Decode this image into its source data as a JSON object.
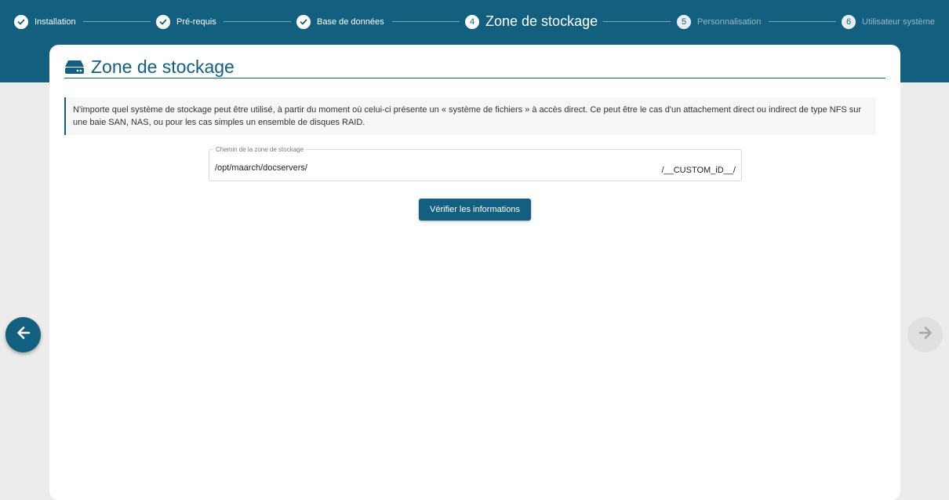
{
  "stepper": {
    "steps": [
      {
        "number": "1",
        "label": "Installation",
        "status": "done"
      },
      {
        "number": "2",
        "label": "Pré-requis",
        "status": "done"
      },
      {
        "number": "3",
        "label": "Base de données",
        "status": "done"
      },
      {
        "number": "4",
        "label": "Zone de stockage",
        "status": "active"
      },
      {
        "number": "5",
        "label": "Personnalisation",
        "status": "pending"
      },
      {
        "number": "6",
        "label": "Utilisateur système",
        "status": "pending"
      }
    ]
  },
  "card": {
    "icon": "hard-drive-icon",
    "title": "Zone de stockage",
    "info": "N'importe quel système de stockage peut être utilisé, à partir du moment où celui-ci présente un « système de fichiers » à accès direct. Ce peut être le cas d'un attachement direct ou indirect de type NFS sur une baie SAN, NAS, ou pour les cas simples un ensemble de disques RAID.",
    "path_field": {
      "label": "Chemin de la zone de stockage",
      "value": "/opt/maarch/docservers/",
      "suffix": "/__CUSTOM_iD__/"
    },
    "verify_button": "Vérifier les informations"
  },
  "navigation": {
    "prev_icon": "arrow-left-icon",
    "next_icon": "arrow-right-icon"
  },
  "colors": {
    "primary": "#135f7f",
    "background": "#ececec"
  }
}
